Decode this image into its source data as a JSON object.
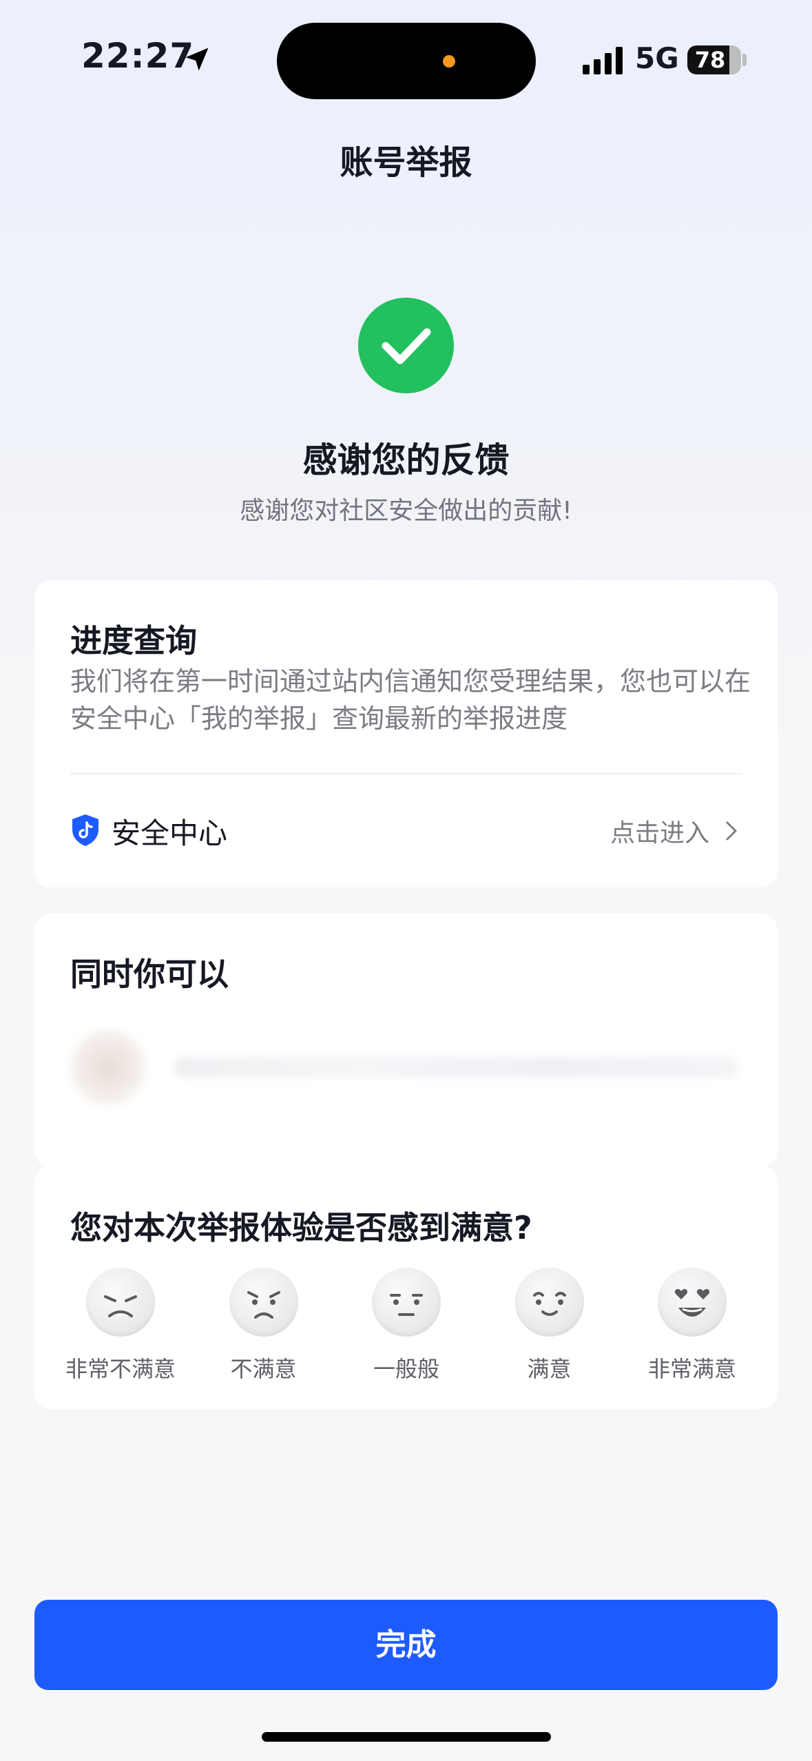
{
  "status_bar": {
    "time": "22:27",
    "network": "5G",
    "battery": "78",
    "battery_level": 0.78
  },
  "header": {
    "title": "账号举报"
  },
  "result": {
    "title": "感谢您的反馈",
    "subtitle": "感谢您对社区安全做出的贡献!"
  },
  "progress_card": {
    "title": "进度查询",
    "description": "我们将在第一时间通过站内信通知您受理结果，您也可以在安全中心「我的举报」查询最新的举报进度",
    "security_center_label": "安全中心",
    "enter_label": "点击进入"
  },
  "also_card": {
    "title": "同时你可以"
  },
  "survey": {
    "question": "您对本次举报体验是否感到满意?",
    "options": [
      {
        "label": "非常不满意",
        "icon": "very-dissatisfied-face-icon"
      },
      {
        "label": "不满意",
        "icon": "dissatisfied-face-icon"
      },
      {
        "label": "一般般",
        "icon": "neutral-face-icon"
      },
      {
        "label": "满意",
        "icon": "satisfied-face-icon"
      },
      {
        "label": "非常满意",
        "icon": "very-satisfied-face-icon"
      }
    ]
  },
  "footer": {
    "done_label": "完成"
  },
  "colors": {
    "success": "#22C05F",
    "primary": "#1E5BFF",
    "shield": "#1E5BFF"
  }
}
